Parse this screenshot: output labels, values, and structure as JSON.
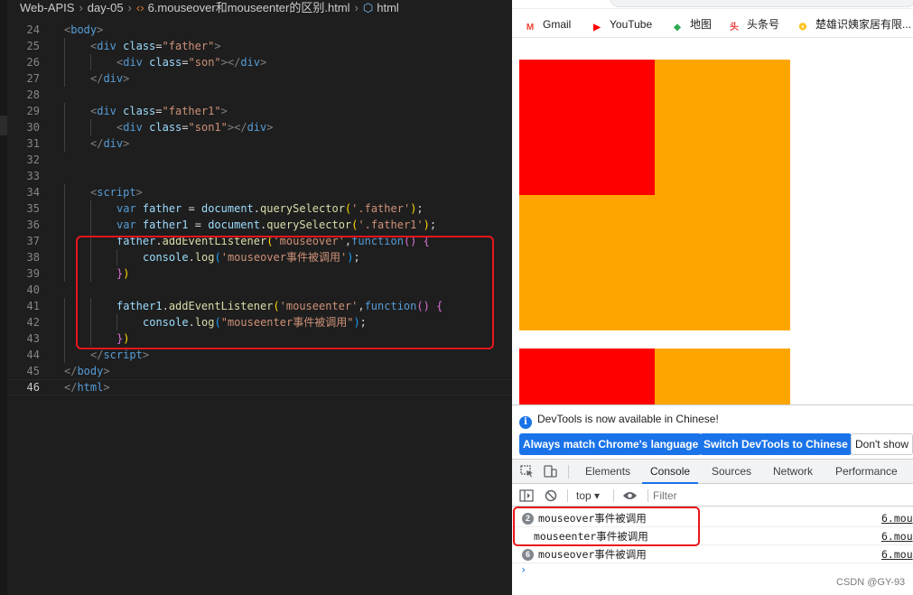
{
  "editor": {
    "breadcrumb": [
      "Web-APIS",
      "day-05",
      "6.mouseover和mouseenter的区别.html",
      "html"
    ],
    "current_line": "46",
    "lines": [
      {
        "n": "24",
        "indent": 0,
        "tokens": [
          [
            "t-br",
            "<"
          ],
          [
            "t-tag",
            "body"
          ],
          [
            "t-br",
            ">"
          ]
        ]
      },
      {
        "n": "25",
        "indent": 1,
        "tokens": [
          [
            "t-br",
            "<"
          ],
          [
            "t-tag",
            "div"
          ],
          [
            "t-op",
            " "
          ],
          [
            "t-attr",
            "class"
          ],
          [
            "t-op",
            "="
          ],
          [
            "t-str",
            "\"father\""
          ],
          [
            "t-br",
            ">"
          ]
        ]
      },
      {
        "n": "26",
        "indent": 2,
        "tokens": [
          [
            "t-br",
            "<"
          ],
          [
            "t-tag",
            "div"
          ],
          [
            "t-op",
            " "
          ],
          [
            "t-attr",
            "class"
          ],
          [
            "t-op",
            "="
          ],
          [
            "t-str",
            "\"son\""
          ],
          [
            "t-br",
            "></"
          ],
          [
            "t-tag",
            "div"
          ],
          [
            "t-br",
            ">"
          ]
        ]
      },
      {
        "n": "27",
        "indent": 1,
        "tokens": [
          [
            "t-br",
            "</"
          ],
          [
            "t-tag",
            "div"
          ],
          [
            "t-br",
            ">"
          ]
        ]
      },
      {
        "n": "28",
        "indent": 0,
        "tokens": []
      },
      {
        "n": "29",
        "indent": 1,
        "tokens": [
          [
            "t-br",
            "<"
          ],
          [
            "t-tag",
            "div"
          ],
          [
            "t-op",
            " "
          ],
          [
            "t-attr",
            "class"
          ],
          [
            "t-op",
            "="
          ],
          [
            "t-str",
            "\"father1\""
          ],
          [
            "t-br",
            ">"
          ]
        ]
      },
      {
        "n": "30",
        "indent": 2,
        "tokens": [
          [
            "t-br",
            "<"
          ],
          [
            "t-tag",
            "div"
          ],
          [
            "t-op",
            " "
          ],
          [
            "t-attr",
            "class"
          ],
          [
            "t-op",
            "="
          ],
          [
            "t-str",
            "\"son1\""
          ],
          [
            "t-br",
            "></"
          ],
          [
            "t-tag",
            "div"
          ],
          [
            "t-br",
            ">"
          ]
        ]
      },
      {
        "n": "31",
        "indent": 1,
        "tokens": [
          [
            "t-br",
            "</"
          ],
          [
            "t-tag",
            "div"
          ],
          [
            "t-br",
            ">"
          ]
        ]
      },
      {
        "n": "32",
        "indent": 0,
        "tokens": []
      },
      {
        "n": "33",
        "indent": 0,
        "tokens": []
      },
      {
        "n": "34",
        "indent": 1,
        "tokens": [
          [
            "t-br",
            "<"
          ],
          [
            "t-tag",
            "script"
          ],
          [
            "t-br",
            ">"
          ]
        ]
      },
      {
        "n": "35",
        "indent": 2,
        "tokens": [
          [
            "t-kw",
            "var"
          ],
          [
            "t-op",
            " "
          ],
          [
            "t-var",
            "father"
          ],
          [
            "t-op",
            " = "
          ],
          [
            "t-var",
            "document"
          ],
          [
            "t-op",
            "."
          ],
          [
            "t-fn",
            "querySelector"
          ],
          [
            "t-p1",
            "("
          ],
          [
            "t-str",
            "'.father'"
          ],
          [
            "t-p1",
            ")"
          ],
          [
            "t-op",
            ";"
          ]
        ]
      },
      {
        "n": "36",
        "indent": 2,
        "tokens": [
          [
            "t-kw",
            "var"
          ],
          [
            "t-op",
            " "
          ],
          [
            "t-var",
            "father1"
          ],
          [
            "t-op",
            " = "
          ],
          [
            "t-var",
            "document"
          ],
          [
            "t-op",
            "."
          ],
          [
            "t-fn",
            "querySelector"
          ],
          [
            "t-p1",
            "("
          ],
          [
            "t-str",
            "'.father1'"
          ],
          [
            "t-p1",
            ")"
          ],
          [
            "t-op",
            ";"
          ]
        ]
      },
      {
        "n": "37",
        "indent": 2,
        "tokens": [
          [
            "t-var",
            "father"
          ],
          [
            "t-op",
            "."
          ],
          [
            "t-fn",
            "addEventListener"
          ],
          [
            "t-p1",
            "("
          ],
          [
            "t-str",
            "'mouseover'"
          ],
          [
            "t-op",
            ","
          ],
          [
            "t-kw",
            "function"
          ],
          [
            "t-p2",
            "()"
          ],
          [
            "t-op",
            " "
          ],
          [
            "t-p2",
            "{"
          ]
        ]
      },
      {
        "n": "38",
        "indent": 3,
        "tokens": [
          [
            "t-var",
            "console"
          ],
          [
            "t-op",
            "."
          ],
          [
            "t-fn",
            "log"
          ],
          [
            "t-p3",
            "("
          ],
          [
            "t-str",
            "'mouseover事件被调用'"
          ],
          [
            "t-p3",
            ")"
          ],
          [
            "t-op",
            ";"
          ]
        ]
      },
      {
        "n": "39",
        "indent": 2,
        "tokens": [
          [
            "t-p2",
            "}"
          ],
          [
            "t-p1",
            ")"
          ]
        ]
      },
      {
        "n": "40",
        "indent": 0,
        "tokens": []
      },
      {
        "n": "41",
        "indent": 2,
        "tokens": [
          [
            "t-var",
            "father1"
          ],
          [
            "t-op",
            "."
          ],
          [
            "t-fn",
            "addEventListener"
          ],
          [
            "t-p1",
            "("
          ],
          [
            "t-str",
            "'mouseenter'"
          ],
          [
            "t-op",
            ","
          ],
          [
            "t-kw",
            "function"
          ],
          [
            "t-p2",
            "()"
          ],
          [
            "t-op",
            " "
          ],
          [
            "t-p2",
            "{"
          ]
        ]
      },
      {
        "n": "42",
        "indent": 3,
        "tokens": [
          [
            "t-var",
            "console"
          ],
          [
            "t-op",
            "."
          ],
          [
            "t-fn",
            "log"
          ],
          [
            "t-p3",
            "("
          ],
          [
            "t-str",
            "\"mouseenter事件被调用\""
          ],
          [
            "t-p3",
            ")"
          ],
          [
            "t-op",
            ";"
          ]
        ]
      },
      {
        "n": "43",
        "indent": 2,
        "tokens": [
          [
            "t-p2",
            "}"
          ],
          [
            "t-p1",
            ")"
          ]
        ]
      },
      {
        "n": "44",
        "indent": 1,
        "tokens": [
          [
            "t-br",
            "</"
          ],
          [
            "t-tag",
            "script"
          ],
          [
            "t-br",
            ">"
          ]
        ]
      },
      {
        "n": "45",
        "indent": 0,
        "tokens": [
          [
            "t-br",
            "</"
          ],
          [
            "t-tag",
            "body"
          ],
          [
            "t-br",
            ">"
          ]
        ]
      },
      {
        "n": "46",
        "indent": 0,
        "tokens": [
          [
            "t-br",
            "</"
          ],
          [
            "t-tag",
            "html"
          ],
          [
            "t-br",
            ">"
          ]
        ]
      }
    ]
  },
  "browser": {
    "bookmarks": [
      {
        "label": "Gmail",
        "icon": "gmail-icon",
        "color": "#ea4335",
        "glyph": "M"
      },
      {
        "label": "YouTube",
        "icon": "youtube-icon",
        "color": "#ff0000",
        "glyph": "▶"
      },
      {
        "label": "地图",
        "icon": "maps-icon",
        "color": "#34a853",
        "glyph": "◆"
      },
      {
        "label": "头条号",
        "icon": "toutiao-icon",
        "color": "#f04142",
        "glyph": "头"
      },
      {
        "label": "楚雄识姨家居有限...",
        "icon": "site-icon",
        "color": "#fbbc05",
        "glyph": "❂"
      }
    ],
    "colors": {
      "father": "#ffa500",
      "son": "#ff0000"
    }
  },
  "devtools": {
    "banner_message": "DevTools is now available in Chinese!",
    "buttons": {
      "match": "Always match Chrome's language",
      "switch": "Switch DevTools to Chinese",
      "dismiss": "Don't show"
    },
    "tabs": [
      "Elements",
      "Console",
      "Sources",
      "Network",
      "Performance"
    ],
    "active_tab": "Console",
    "context": "top ▾",
    "filter_placeholder": "Filter",
    "messages": [
      {
        "count": "2",
        "text": "mouseover事件被调用",
        "source": "6.mou"
      },
      {
        "count": "",
        "text": "mouseenter事件被调用",
        "source": "6.mou"
      },
      {
        "count": "6",
        "text": "mouseover事件被调用",
        "source": "6.mou"
      }
    ],
    "prompt": "›"
  },
  "watermark": "CSDN @GY-93"
}
